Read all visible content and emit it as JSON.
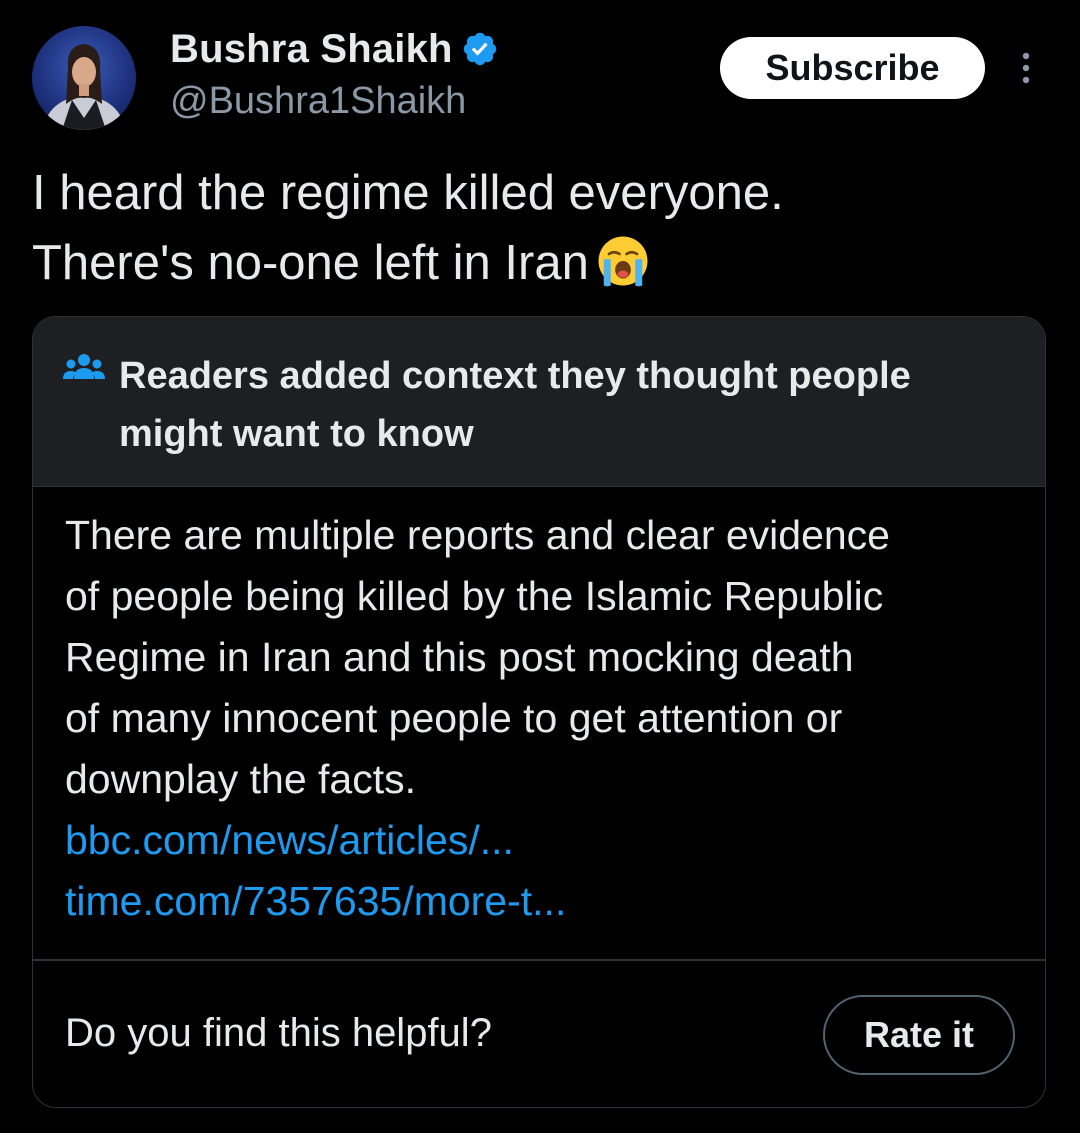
{
  "author": {
    "display_name": "Bushra Shaikh",
    "handle": "@Bushra1Shaikh",
    "verified": true
  },
  "header": {
    "subscribe_label": "Subscribe",
    "more_icon": "more-vertical-icon"
  },
  "tweet": {
    "text_lines": [
      "I heard the regime killed everyone.",
      "There's no-one left in Iran"
    ],
    "emoji": "loudly-crying-face"
  },
  "note": {
    "title": "Readers added context they thought people might want to know",
    "body_lines": [
      "There are multiple reports and clear evidence",
      "of people being killed by the Islamic Republic",
      "Regime in Iran and this post mocking death",
      "of many innocent people to get attention or",
      "downplay the facts."
    ],
    "links": [
      "bbc.com/news/articles/...",
      "time.com/7357635/more-t..."
    ],
    "helpful_question": "Do you find this helpful?",
    "rate_label": "Rate it"
  },
  "colors": {
    "background": "#000000",
    "text": "#e7e9ea",
    "secondary_text": "#8b98a5",
    "link": "#1d9bf0",
    "verified_badge": "#1d9bf0",
    "note_header_bg": "#1d1f23",
    "border": "#2f3336"
  }
}
